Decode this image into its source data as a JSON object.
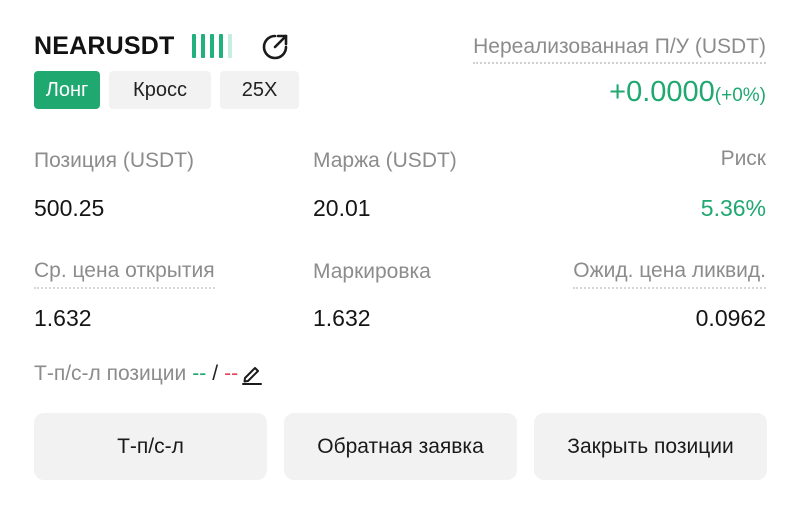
{
  "header": {
    "symbol": "NEARUSDT",
    "signal_bars": {
      "total": 5,
      "filled": 4
    },
    "share_icon": "share-icon",
    "position_side": "Лонг",
    "margin_mode": "Кросс",
    "leverage": "25X",
    "unrealized_label": "Нереализованная П/У (USDT)",
    "unrealized_value": "+0.0000",
    "unrealized_percent": "(+0%)"
  },
  "stats": {
    "position_label": "Позиция (USDT)",
    "position_value": "500.25",
    "margin_label": "Маржа (USDT)",
    "margin_value": "20.01",
    "risk_label": "Риск",
    "risk_value": "5.36%",
    "entry_label": "Ср. цена открытия",
    "entry_value": "1.632",
    "mark_label": "Маркировка",
    "mark_value": "1.632",
    "liq_label": "Ожид. цена ликвид.",
    "liq_value": "0.0962"
  },
  "tpsl": {
    "label": "Т-п/с-л позиции",
    "tp_value": "--",
    "separator": "/",
    "sl_value": "--",
    "edit_icon": "pencil-icon"
  },
  "actions": {
    "tpsl_button": "Т-п/с-л",
    "reverse_button": "Обратная заявка",
    "close_button": "Закрыть позиции"
  },
  "colors": {
    "accent_green": "#1fa870",
    "loss_red": "#e2465b",
    "muted_text": "#8c8c8c",
    "chip_bg": "#f2f2f2"
  }
}
